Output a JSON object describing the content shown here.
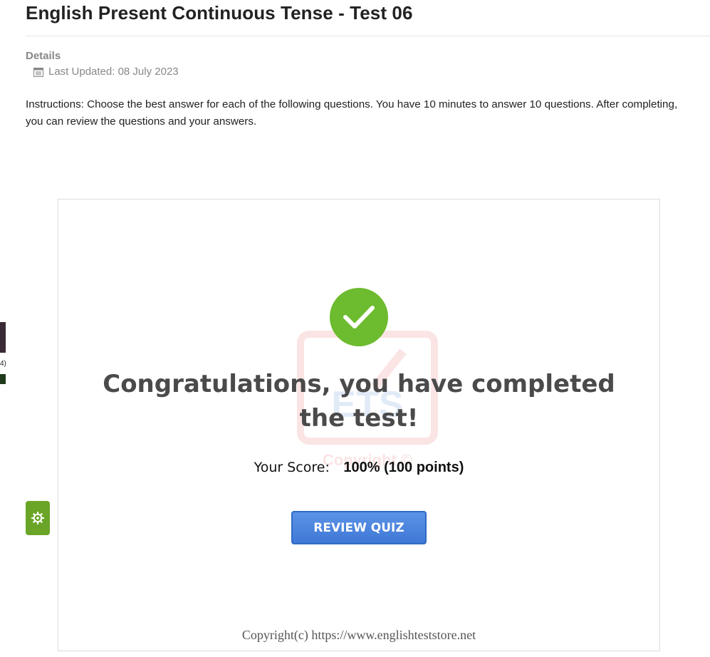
{
  "page": {
    "title": "English Present Continuous Tense - Test 06",
    "details_label": "Details",
    "last_updated": "Last Updated: 08 July 2023",
    "instructions": "Instructions: Choose the best answer for each of the following questions. You have 10 minutes to answer 10 questions. After completing, you can review the questions and your answers."
  },
  "quiz": {
    "congrats": "Congratulations, you have completed the test!",
    "score_label": "Your Score:",
    "score_value": "100% (100 points)",
    "review_button": "REVIEW QUIZ",
    "copyright": "Copyright(c) https://www.englishteststore.net",
    "watermark_text": "ETS",
    "watermark_copyright": "Copyright ©"
  },
  "sidebar_edge": {
    "label": "4)"
  },
  "icons": {
    "calendar": "calendar-icon",
    "check": "check-icon",
    "settings": "gear-icon"
  },
  "colors": {
    "accent_green": "#6dbb2e",
    "settings_green": "#6aa527",
    "button_blue": "#3f78d6"
  }
}
